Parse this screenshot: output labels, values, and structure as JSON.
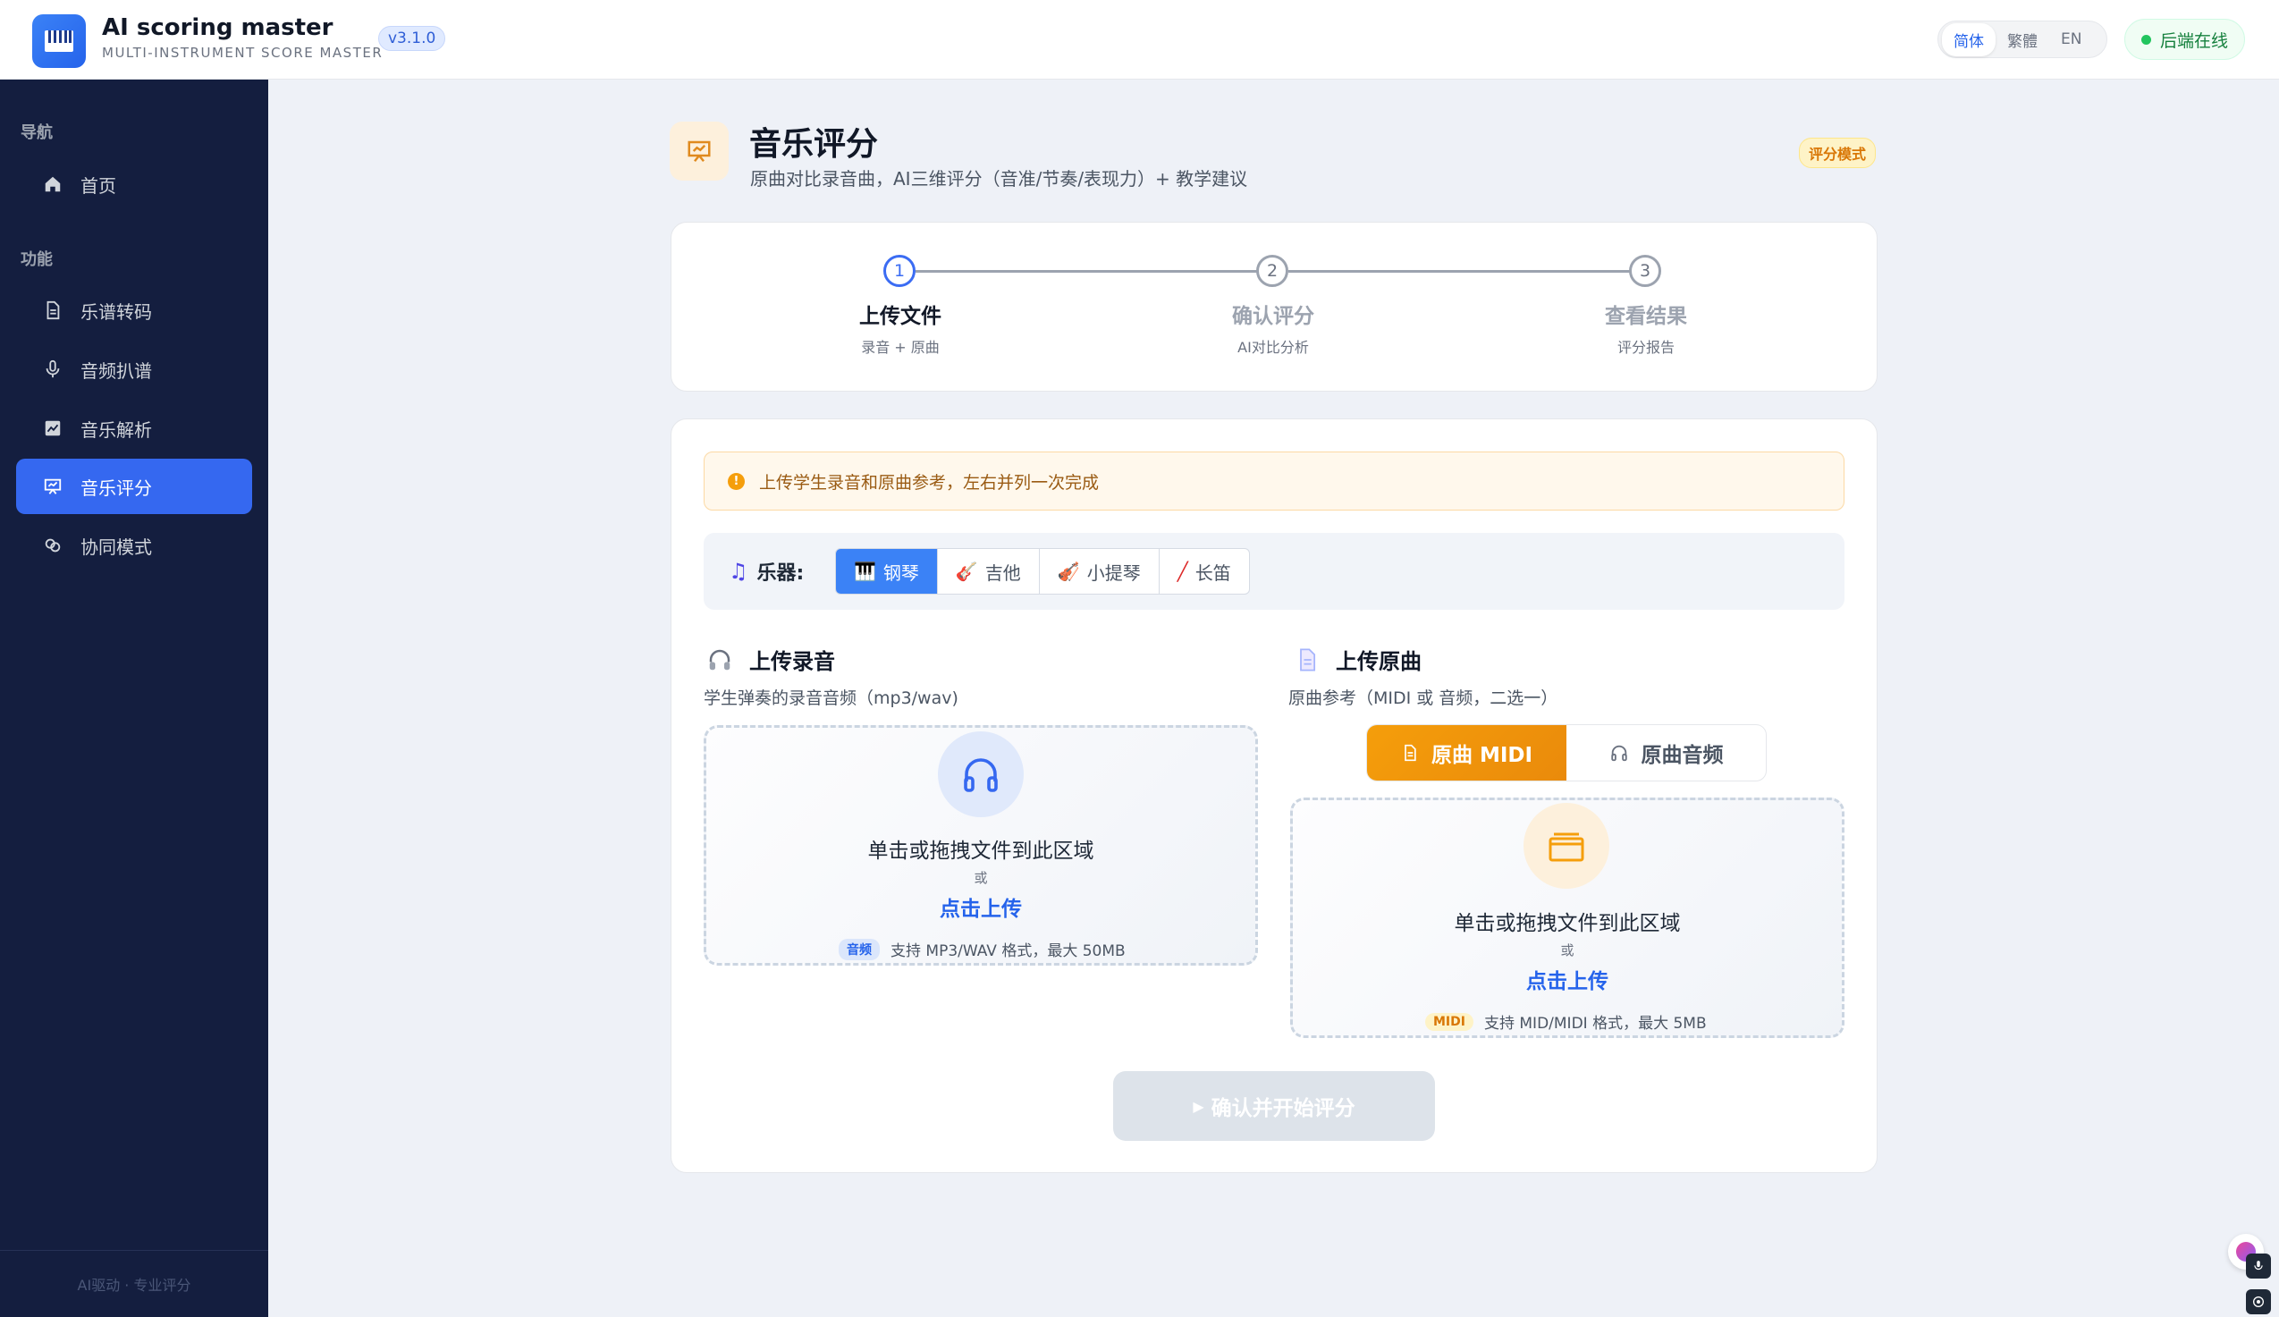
{
  "header": {
    "app_title": "AI scoring master",
    "app_subtitle": "MULTI-INSTRUMENT SCORE MASTER",
    "version": "v3.1.0",
    "languages": [
      "简体",
      "繁體",
      "EN"
    ],
    "active_language": "简体",
    "status": "后端在线"
  },
  "sidebar": {
    "section_nav": "导航",
    "section_func": "功能",
    "items": [
      {
        "label": "首页",
        "icon": "home-icon"
      },
      {
        "label": "乐谱转码",
        "icon": "document-icon"
      },
      {
        "label": "音频扒谱",
        "icon": "microphone-icon"
      },
      {
        "label": "音乐解析",
        "icon": "chart-icon"
      },
      {
        "label": "音乐评分",
        "icon": "presentation-icon",
        "active": true
      },
      {
        "label": "协同模式",
        "icon": "link-icon"
      }
    ],
    "footer": "AI驱动 · 专业评分"
  },
  "page": {
    "title": "音乐评分",
    "subtitle": "原曲对比录音曲，AI三维评分（音准/节奏/表现力）+ 教学建议",
    "mode_badge": "评分模式"
  },
  "steps": [
    {
      "num": "1",
      "label": "上传文件",
      "desc": "录音 + 原曲",
      "active": true
    },
    {
      "num": "2",
      "label": "确认评分",
      "desc": "AI对比分析",
      "active": false
    },
    {
      "num": "3",
      "label": "查看结果",
      "desc": "评分报告",
      "active": false
    }
  ],
  "notice": "上传学生录音和原曲参考，左右并列一次完成",
  "instrument": {
    "label": "乐器:",
    "options": [
      "钢琴",
      "吉他",
      "小提琴",
      "长笛"
    ],
    "selected": "钢琴"
  },
  "recording": {
    "title": "上传录音",
    "subtitle": "学生弹奏的录音音频（mp3/wav)",
    "drop_text": "单击或拖拽文件到此区域",
    "or": "或",
    "link": "点击上传",
    "badge": "音频",
    "hint": "支持 MP3/WAV 格式，最大 50MB"
  },
  "original": {
    "title": "上传原曲",
    "subtitle": "原曲参考（MIDI 或 音频，二选一）",
    "toggle_midi": "原曲 MIDI",
    "toggle_audio": "原曲音频",
    "drop_text": "单击或拖拽文件到此区域",
    "or": "或",
    "link": "点击上传",
    "badge": "MIDI",
    "hint": "支持 MID/MIDI 格式，最大 5MB"
  },
  "submit_label": "确认并开始评分",
  "colors": {
    "accent": "#3568f0",
    "sidebar_bg": "#141e3f",
    "midi_orange": "#f59e0b",
    "status_green": "#22c55e"
  }
}
